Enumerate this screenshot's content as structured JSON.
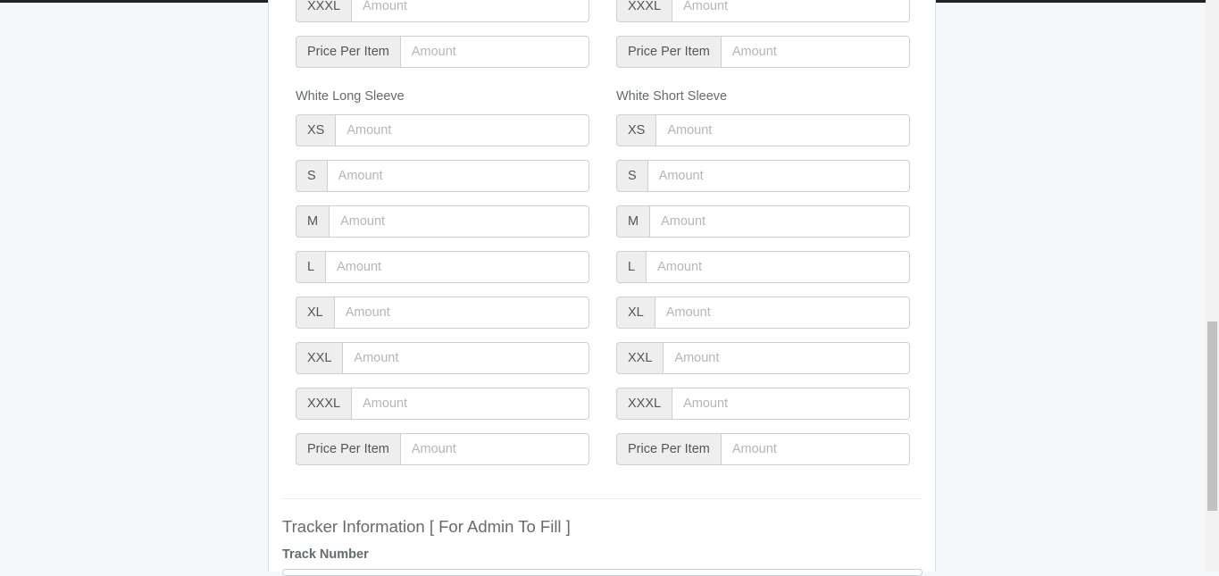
{
  "placeholder": "Amount",
  "top_partial": {
    "left": {
      "size": "XXXL",
      "price_label": "Price Per Item"
    },
    "right": {
      "size": "XXXL",
      "price_label": "Price Per Item"
    }
  },
  "white_long_sleeve": {
    "title": "White Long Sleeve",
    "sizes": [
      "XS",
      "S",
      "M",
      "L",
      "XL",
      "XXL",
      "XXXL"
    ],
    "price_label": "Price Per Item"
  },
  "white_short_sleeve": {
    "title": "White Short Sleeve",
    "sizes": [
      "XS",
      "S",
      "M",
      "L",
      "XL",
      "XXL",
      "XXXL"
    ],
    "price_label": "Price Per Item"
  },
  "tracker": {
    "title": "Tracker Information [ For Admin To Fill ]",
    "track_number_label": "Track Number"
  }
}
